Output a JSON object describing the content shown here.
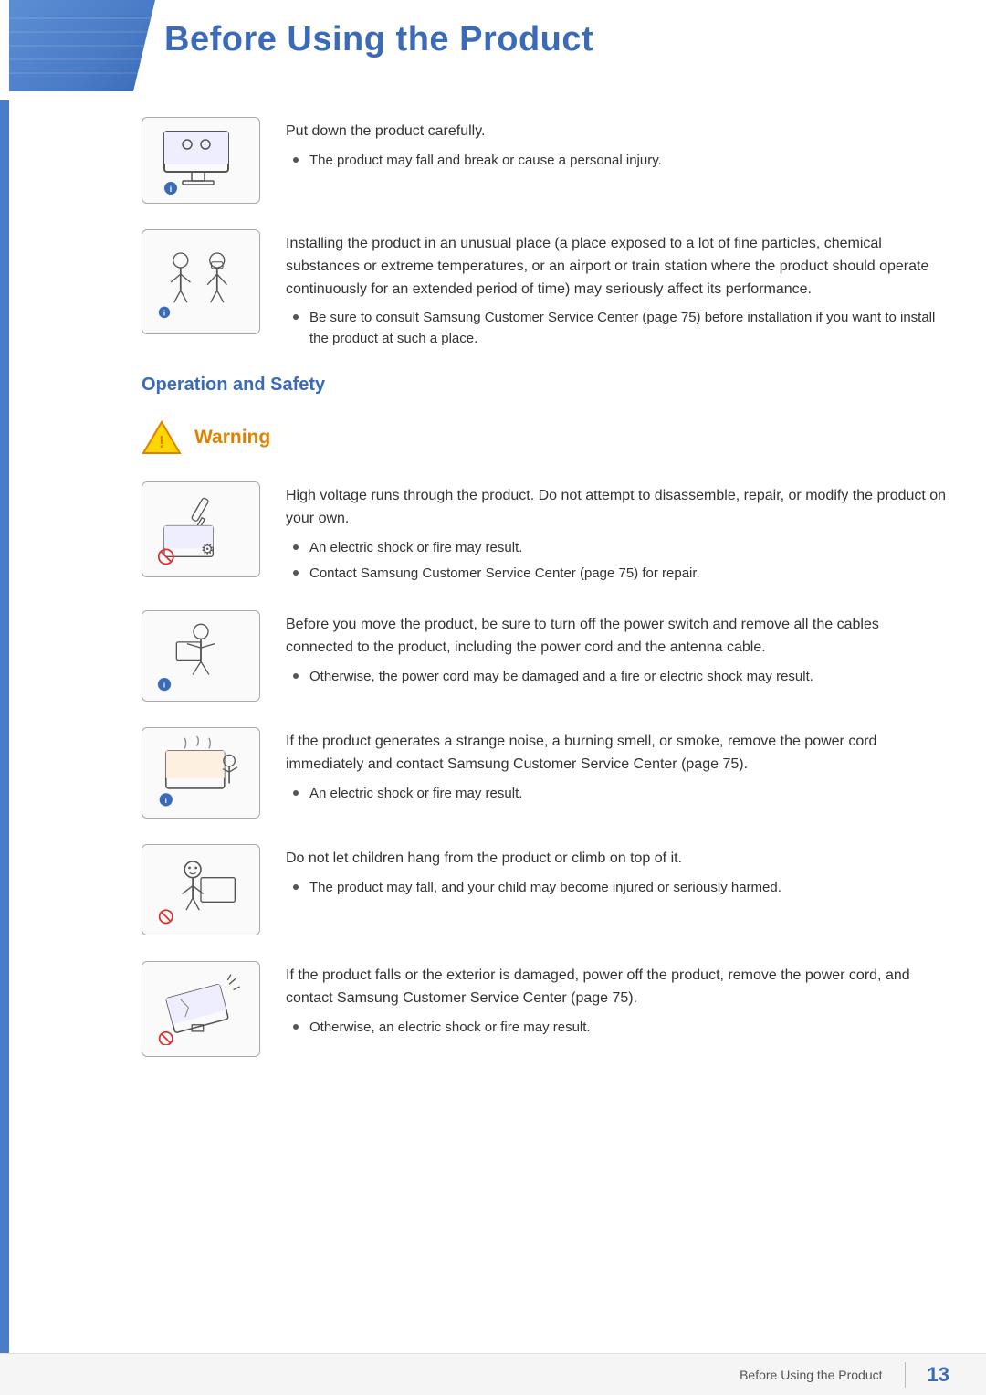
{
  "header": {
    "title": "Before Using the Product"
  },
  "instructions": [
    {
      "id": "put-down",
      "main_text": "Put down the product carefully.",
      "bullets": [
        "The product may fall and break or cause a personal injury."
      ]
    },
    {
      "id": "unusual-place",
      "main_text": "Installing the product in an unusual place (a place exposed to a lot of fine particles, chemical substances or extreme temperatures, or an airport or train station where the product should operate continuously for an extended period of time) may seriously affect its performance.",
      "bullets": [
        "Be sure to consult Samsung Customer Service Center (page 75) before installation if you want to install the product at such a place."
      ]
    }
  ],
  "operation_safety": {
    "heading": "Operation and Safety",
    "warning_label": "Warning",
    "warning_blocks": [
      {
        "id": "high-voltage",
        "main_text": "High voltage runs through the product. Do not attempt to disassemble, repair, or modify the product on your own.",
        "bullets": [
          "An electric shock or fire may result.",
          "Contact Samsung Customer Service Center (page 75) for repair."
        ]
      },
      {
        "id": "move-product",
        "main_text": "Before you move the product, be sure to turn off the power switch and remove all the cables connected to the product, including the power cord and the antenna cable.",
        "bullets": [
          "Otherwise, the power cord may be damaged and a fire or electric shock may result."
        ]
      },
      {
        "id": "strange-noise",
        "main_text": "If the product generates a strange noise, a burning smell, or smoke, remove the power cord immediately and contact Samsung Customer Service Center (page 75).",
        "bullets": [
          "An electric shock or fire may result."
        ]
      },
      {
        "id": "children-hang",
        "main_text": "Do not let children hang from the product or climb on top of it.",
        "bullets": [
          "The product may fall, and your child may become injured or seriously harmed."
        ]
      },
      {
        "id": "product-falls",
        "main_text": "If the product falls or the exterior is damaged, power off the product, remove the power cord, and contact Samsung Customer Service Center (page 75).",
        "bullets": [
          "Otherwise, an electric shock or fire may result."
        ]
      }
    ]
  },
  "footer": {
    "text": "Before Using the Product",
    "page_number": "13"
  }
}
